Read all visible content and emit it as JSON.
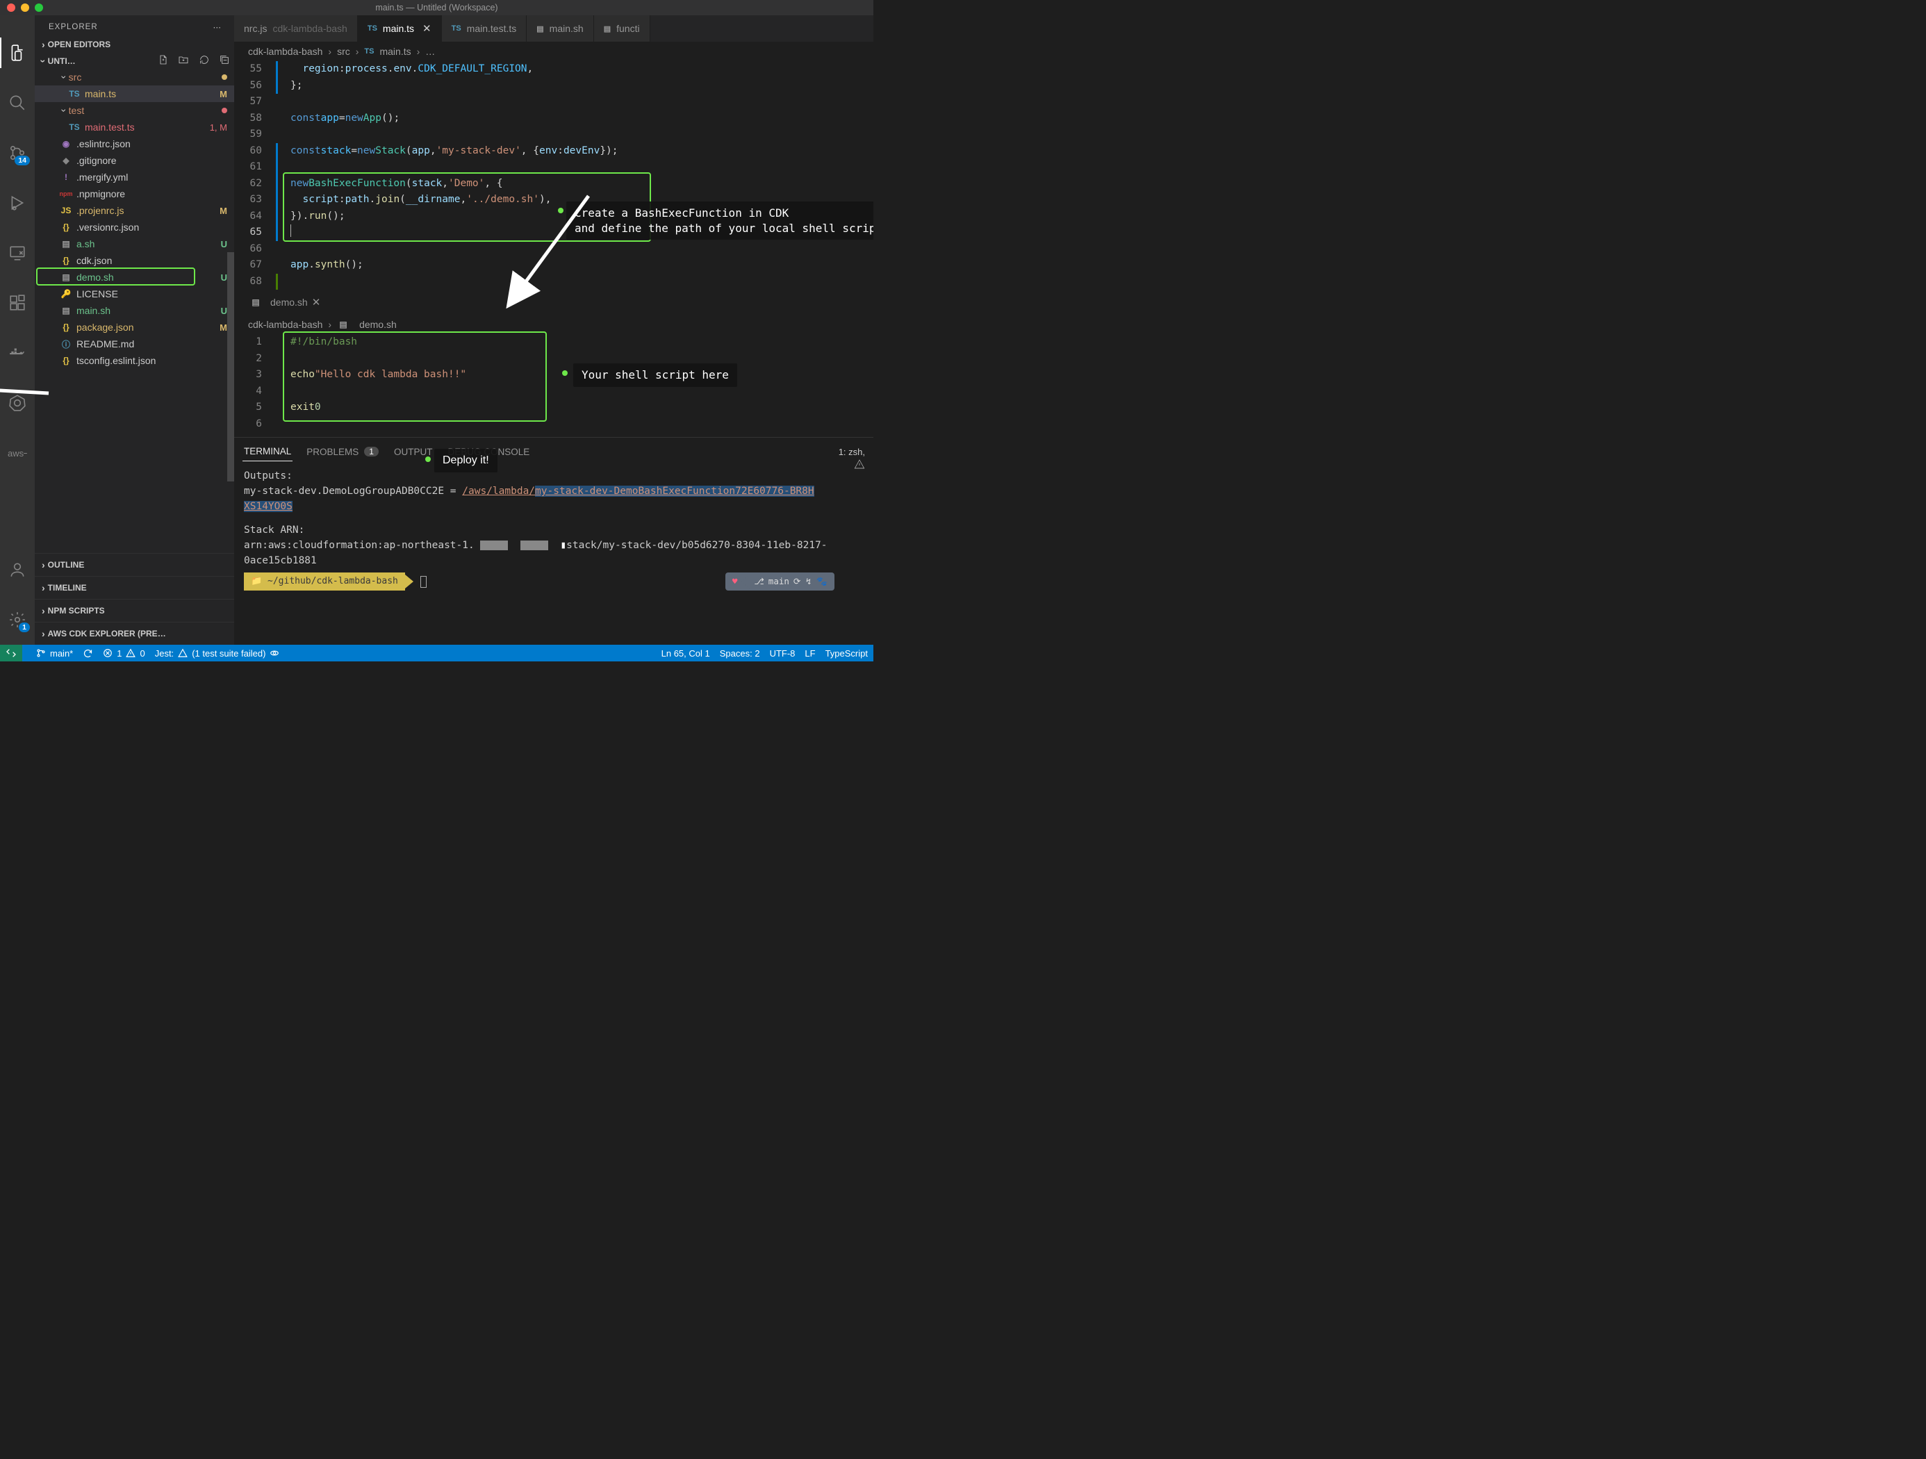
{
  "window_title": "main.ts — Untitled (Workspace)",
  "activity_badges": {
    "scm": "14",
    "settings": "1"
  },
  "sidebar": {
    "title": "EXPLORER",
    "open_editors": "OPEN EDITORS",
    "project": "UNTI…",
    "outline": "OUTLINE",
    "timeline": "TIMELINE",
    "npm": "NPM SCRIPTS",
    "cdk": "AWS CDK EXPLORER (PRE…",
    "tree": {
      "src": "src",
      "main_ts": "main.ts",
      "test": "test",
      "main_test_ts": "main.test.ts",
      "main_test_badge": "1, M",
      "eslintrc": ".eslintrc.json",
      "gitignore": ".gitignore",
      "mergify": ".mergify.yml",
      "npmignore": ".npmignore",
      "projenrc": ".projenrc.js",
      "versionrc": ".versionrc.json",
      "ash": "a.sh",
      "cdkjson": "cdk.json",
      "demosh": "demo.sh",
      "license": "LICENSE",
      "mainsh": "main.sh",
      "pkgjson": "package.json",
      "readme": "README.md",
      "tsconfig": "tsconfig.eslint.json"
    }
  },
  "tabs": {
    "t0": "nrc.js",
    "t0_ext": "cdk-lambda-bash",
    "t1": "main.ts",
    "t2": "main.test.ts",
    "t3": "main.sh",
    "t4": "functi"
  },
  "breadcrumb": {
    "a": "cdk-lambda-bash",
    "b": "src",
    "c": "main.ts",
    "d": "…"
  },
  "code1": {
    "l55a": "region",
    "l55b": "process",
    "l55c": "env",
    "l55d": "CDK_DEFAULT_REGION",
    "l58a": "const",
    "l58b": "app",
    "l58c": "new",
    "l58d": "App",
    "l60a": "const",
    "l60b": "stack",
    "l60c": "new",
    "l60d": "Stack",
    "l60e": "app",
    "l60f": "'my-stack-dev'",
    "l60g": "env",
    "l60h": "devEnv",
    "l62a": "new",
    "l62b": "BashExecFunction",
    "l62c": "stack",
    "l62d": "'Demo'",
    "l63a": "script",
    "l63b": "path",
    "l63c": "join",
    "l63d": "__dirname",
    "l63e": "'../demo.sh'",
    "l64a": "run",
    "l67a": "app",
    "l67b": "synth"
  },
  "lower_tab": "demo.sh",
  "breadcrumb2": {
    "a": "cdk-lambda-bash",
    "b": "demo.sh"
  },
  "code2": {
    "shebang": "#!/bin/bash",
    "echo_kw": "echo",
    "echo_str": "\"Hello cdk lambda bash!!\"",
    "exit_kw": "exit",
    "exit_n": "0"
  },
  "annotations": {
    "a1": "Create a BashExecFunction in CDK\nand define the path of your local shell script",
    "a2": "Your shell script here",
    "a3": "Deploy it!"
  },
  "panel": {
    "terminal": "TERMINAL",
    "problems": "PROBLEMS",
    "problems_n": "1",
    "output": "OUTPUT",
    "debug": "DEBUG CONSOLE",
    "right": "1: zsh,"
  },
  "terminal": {
    "l1": "Outputs:",
    "l2a": "my-stack-dev.DemoLogGroupADB0CC2E = ",
    "l2b": "/aws/lambda/",
    "l2c": "my-stack-dev-DemoBashExecFunction72E60776-BR8H",
    "l2d": "XS14YO0S",
    "l4": "Stack ARN:",
    "l5a": "arn:aws:cloudformation:ap-northeast-1.",
    "l5b": "stack/my-stack-dev/b05d6270-8304-11eb-8217-",
    "l5c": "0ace15cb1881",
    "prompt_path": " ~/github/cdk-lambda-bash ",
    "git_branch": "main"
  },
  "status": {
    "branch": "main*",
    "err": "1",
    "warn": "0",
    "jest": "Jest:",
    "jest_msg": "(1 test suite failed)",
    "ln": "Ln 65, Col 1",
    "spaces": "Spaces: 2",
    "enc": "UTF-8",
    "eol": "LF",
    "lang": "TypeScript"
  }
}
